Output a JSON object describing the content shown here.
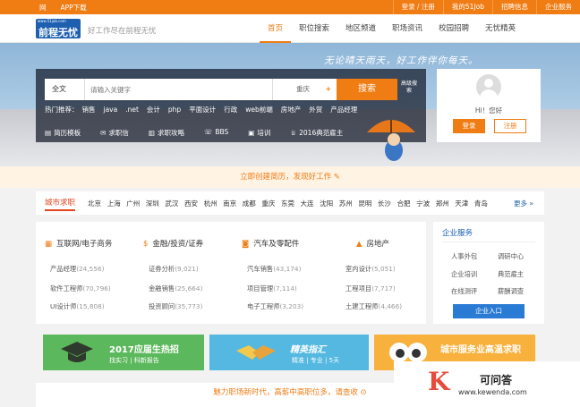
{
  "topbar": {
    "left": [
      "网",
      "APP下载"
    ],
    "right": [
      "登录 / 注册",
      "我的51Job",
      "招聘信息",
      "企业服务"
    ]
  },
  "header": {
    "logo": "前程无忧",
    "logo_url": "www.51job.com",
    "slogan": "好工作尽在前程无忧",
    "nav": [
      "首页",
      "职位搜索",
      "地区频道",
      "职场资讯",
      "校园招聘",
      "无忧精英"
    ]
  },
  "hero": {
    "slogan": "无论晴天雨天，好工作伴你每天。"
  },
  "search": {
    "type": "全文",
    "placeholder": "请输入关键字",
    "city": "重庆",
    "plus": "+",
    "button": "搜索",
    "advanced": "高级搜索",
    "hot_label": "热门推荐：",
    "hot": [
      "销售",
      "java",
      ".net",
      "会计",
      "php",
      "平面设计",
      "行政",
      "web前端",
      "房地产",
      "外贸",
      "产品经理"
    ],
    "tools": [
      {
        "icon": "▤",
        "label": "简历模板"
      },
      {
        "icon": "✉",
        "label": "求职信"
      },
      {
        "icon": "▥",
        "label": "求职攻略"
      },
      {
        "icon": "☏",
        "label": "BBS"
      },
      {
        "icon": "▣",
        "label": "培训"
      },
      {
        "icon": "♕",
        "label": "2016典范雇主"
      }
    ]
  },
  "login": {
    "hi": "Hi！您好",
    "login": "登录",
    "register": "注册"
  },
  "resume_bar": "立即创建简历，发现好工作",
  "cityjobs": {
    "title": "城市求职",
    "cities": [
      "北京",
      "上海",
      "广州",
      "深圳",
      "武汉",
      "西安",
      "杭州",
      "南京",
      "成都",
      "重庆",
      "东莞",
      "大连",
      "沈阳",
      "苏州",
      "昆明",
      "长沙",
      "合肥",
      "宁波",
      "郑州",
      "天津",
      "青岛"
    ],
    "more": "更多 »"
  },
  "categories": [
    {
      "icon": "▦",
      "title": "互联网/电子商务",
      "items": [
        {
          "name": "产品经理",
          "count": "(24,556)"
        },
        {
          "name": "软件工程师",
          "count": "(70,796)"
        },
        {
          "name": "UI设计师",
          "count": "(15,808)"
        }
      ]
    },
    {
      "icon": "$",
      "title": "金融/投资/证券",
      "items": [
        {
          "name": "证券分析",
          "count": "(9,021)"
        },
        {
          "name": "金融销售",
          "count": "(25,664)"
        },
        {
          "name": "投资顾问",
          "count": "(35,773)"
        }
      ]
    },
    {
      "icon": "◙",
      "title": "汽车及零配件",
      "items": [
        {
          "name": "汽车销售",
          "count": "(43,174)"
        },
        {
          "name": "项目管理",
          "count": "(7,114)"
        },
        {
          "name": "电子工程师",
          "count": "(3,203)"
        }
      ]
    },
    {
      "icon": "▲",
      "title": "房地产",
      "items": [
        {
          "name": "室内设计",
          "count": "(5,051)"
        },
        {
          "name": "工程项目",
          "count": "(7,717)"
        },
        {
          "name": "土建工程师",
          "count": "(4,466)"
        }
      ]
    }
  ],
  "services": {
    "title": "企业服务",
    "items": [
      "人事外包",
      "调研中心",
      "企业培训",
      "典范雇主",
      "在线测评",
      "薪酬调查"
    ],
    "button": "企业入口"
  },
  "banners": [
    {
      "title": "2017应届生热招",
      "sub": "找实习 | 科新报告"
    },
    {
      "title": "精英指汇",
      "sub": "精准 | 专业 | 5天"
    },
    {
      "title": "城市服务业高温求职",
      "sub": ""
    }
  ],
  "bottom_bar": "魅力职场新时代，高薪中高职位多，请查收",
  "watermark": {
    "k": "K",
    "name": "可问答",
    "url": "www.kewenda.com"
  },
  "colors": {
    "brand": "#f07c14",
    "blue": "#1e5fb0"
  }
}
